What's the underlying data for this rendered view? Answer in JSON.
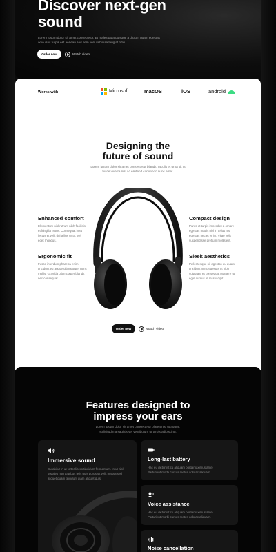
{
  "hero": {
    "title": "Discover next-gen sound",
    "description": "Lorem ipsum dolor sit amet consectetur. Et malesuada quisque a dictum quam egestas odio duis turpis est aenean sed sem velit vehicula feugiat odio.",
    "order_button": "Order now",
    "watch_label": "Watch video"
  },
  "works_with": {
    "label": "Works with",
    "logos": [
      "Microsoft",
      "macOS",
      "iOS",
      "android"
    ]
  },
  "design": {
    "title": "Designing the future of sound",
    "description": "Lorem ipsum dolor sit amet consectetur blandit. Iaculis et urna sit ut fusce viverra nisi ac eleifend commodo nunc amet.",
    "features": [
      {
        "title": "Enhanced comfort",
        "text": "Elementum nisl rutrum nibh facilisis et fringilla netus. Consequat in et lectus et velit dui tellus urna. Vel eget rhoncus."
      },
      {
        "title": "Compact design",
        "text": "Purus ut turpis imperdiet a ornare egestas mattis nisl in tellus nisi egestas nec et enim. Vitae velit suspendisse pretium mollis elit."
      },
      {
        "title": "Ergonomic fit",
        "text": "Fusce interdum pharetra enim tincidunt eu augue ullamcorper nunc mollis. Gravida ullamcorper blandit nec consequat."
      },
      {
        "title": "Sleek aesthetics",
        "text": "Pellentesque sit egestas eu quam tincidunt nunc egestas ut nibh vulputate et consequat posuere ut eget cursus et mi suscipit."
      }
    ],
    "order_button": "Order now",
    "watch_label": "Watch video"
  },
  "features_section": {
    "title": "Features designed to impress your ears",
    "description": "Lorem ipsum dolor sit amet consectetur platea nisi ut augue, sollicitudin a sagittis vel vestibulum ut turpis adipiscing.",
    "immersive": {
      "title": "Immersive sound",
      "text": "Curabitur in ut tortor libero tincidunt fermentum. In ut nisl sodales non dapibus felis quis purus sit velit massa sed aliquet quam tincidunt diam aliquet quis."
    },
    "cards": [
      {
        "title": "Long-last battery",
        "text": "Hac eu dictumst cu aliquam porta maximus ante. Parturient morbi cursus metus odio ac aliquam."
      },
      {
        "title": "Voice assistance",
        "text": "Hac eu dictumst cu aliquam porta maximus ante. Parturient morbi cursus metus odio ac aliquam."
      },
      {
        "title": "Noise cancellation",
        "text": ""
      }
    ]
  },
  "colors": {
    "accent_dark": "#111111",
    "android_green": "#3ddc84",
    "ms_red": "#f25022",
    "ms_green": "#7fba00",
    "ms_blue": "#00a4ef",
    "ms_yellow": "#ffb900"
  }
}
